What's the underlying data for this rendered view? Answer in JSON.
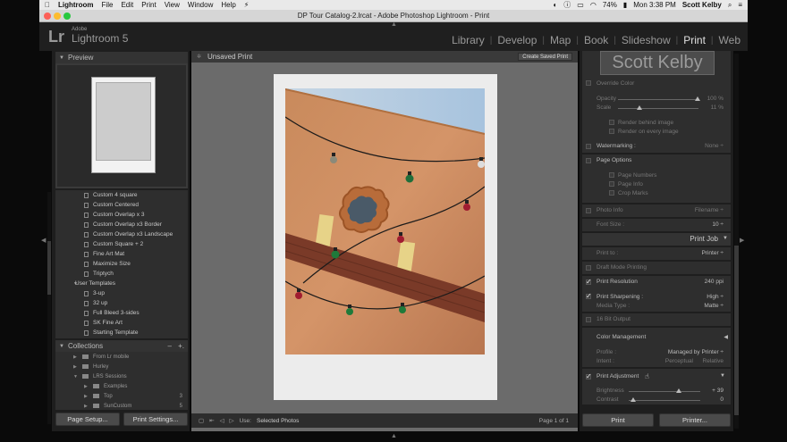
{
  "menubar": {
    "app": "Lightroom",
    "items": [
      "File",
      "Edit",
      "Print",
      "View",
      "Window",
      "Help"
    ],
    "battery": "74%",
    "clock": "Mon 3:38 PM",
    "user": "Scott Kelby"
  },
  "window": {
    "title": "DP Tour Catalog-2.lrcat - Adobe Photoshop Lightroom - Print"
  },
  "brand": {
    "logo": "Lr",
    "top": "Adobe",
    "name": "Lightroom 5"
  },
  "modules": [
    "Library",
    "Develop",
    "Map",
    "Book",
    "Slideshow",
    "Print",
    "Web"
  ],
  "active_module": "Print",
  "left": {
    "preview_title": "Preview",
    "templates": [
      {
        "label": "Custom 4 square",
        "type": "item"
      },
      {
        "label": "Custom Centered",
        "type": "item"
      },
      {
        "label": "Custom Overlap x 3",
        "type": "item"
      },
      {
        "label": "Custom Overlap x3 Border",
        "type": "item"
      },
      {
        "label": "Custom Overlap x3 Landscape",
        "type": "item"
      },
      {
        "label": "Custom Square + 2",
        "type": "item"
      },
      {
        "label": "Fine Art Mat",
        "type": "item"
      },
      {
        "label": "Maximize Size",
        "type": "item"
      },
      {
        "label": "Triptych",
        "type": "item"
      },
      {
        "label": "User Templates",
        "type": "folder"
      },
      {
        "label": "3-up",
        "type": "item"
      },
      {
        "label": "32 up",
        "type": "item"
      },
      {
        "label": "Full Bleed 3-sides",
        "type": "item"
      },
      {
        "label": "SK Fine Art",
        "type": "item"
      },
      {
        "label": "Starting Template",
        "type": "item"
      }
    ],
    "collections_title": "Collections",
    "collections_controls": [
      "–",
      "+."
    ],
    "collections": [
      {
        "label": "From Lr mobile",
        "count": ""
      },
      {
        "label": "Hurley",
        "count": ""
      },
      {
        "label": "LRS Sessions",
        "count": ""
      },
      {
        "label": "Examples",
        "count": "",
        "indent": true
      },
      {
        "label": "Top",
        "count": "3",
        "indent": true
      },
      {
        "label": "SunCustom",
        "count": "5",
        "indent": true
      }
    ],
    "page_setup": "Page Setup...",
    "print_settings": "Print Settings..."
  },
  "center": {
    "title": "Unsaved Print",
    "create_saved": "Create Saved Print",
    "use_label": "Use:",
    "use_value": "Selected Photos",
    "page": "Page 1 of 1"
  },
  "right": {
    "identity": "Scott Kelby",
    "override_color": "Override Color",
    "opacity_label": "Opacity",
    "opacity_value": "100 %",
    "scale_label": "Scale",
    "scale_value": "11 %",
    "render_behind": "Render behind image",
    "render_every": "Render on every image",
    "watermarking": "Watermarking :",
    "watermark_value": "None ÷",
    "page_options": "Page Options",
    "page_numbers": "Page Numbers",
    "page_info": "Page Info",
    "crop_marks": "Crop Marks",
    "photo_info": "Photo Info",
    "photo_info_value": "Filename ÷",
    "font_size": "Font Size :",
    "font_size_value": "10 ÷",
    "print_job": "Print Job",
    "print_to": "Print to :",
    "print_to_value": "Printer ÷",
    "draft_mode": "Draft Mode Printing",
    "print_resolution": "Print Resolution",
    "resolution_value": "240 ppi",
    "print_sharpening": "Print Sharpening :",
    "sharpening_value": "High ÷",
    "media_type": "Media Type :",
    "media_value": "Matte ÷",
    "bit": "16 Bit Output",
    "color_mgmt": "Color Management",
    "profile": "Profile :",
    "profile_value": "Managed by Printer ÷",
    "intent": "Intent :",
    "perceptual": "Perceptual",
    "relative": "Relative",
    "print_adjustment": "Print Adjustment",
    "brightness": "Brightness",
    "brightness_value": "+ 39",
    "contrast": "Contrast",
    "contrast_value": "0",
    "print_btn": "Print",
    "printer_btn": "Printer..."
  }
}
